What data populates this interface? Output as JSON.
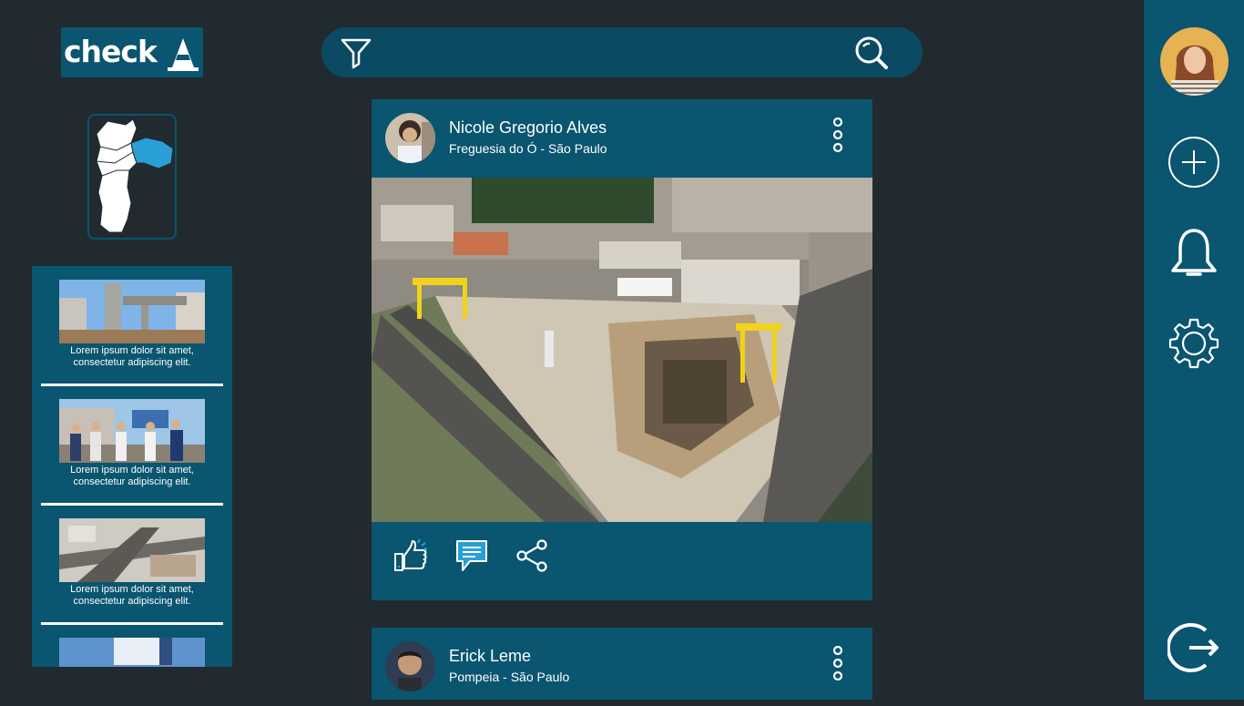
{
  "brand": {
    "logo_text": "check"
  },
  "search": {
    "value": "",
    "placeholder": "",
    "filter_icon": "filter-icon",
    "search_icon": "search-icon"
  },
  "news": {
    "items": [
      {
        "caption_line1": "Lorem ipsum dolor sit amet,",
        "caption_line2": "consectetur adipiscing elit."
      },
      {
        "caption_line1": "Lorem ipsum dolor sit amet,",
        "caption_line2": "consectetur adipiscing elit."
      },
      {
        "caption_line1": "Lorem ipsum dolor sit amet,",
        "caption_line2": "consectetur adipiscing elit."
      }
    ]
  },
  "posts": [
    {
      "author": "Nicole Gregorio Alves",
      "location": "Freguesia do Ó - São Paulo"
    },
    {
      "author": "Erick Leme",
      "location": "Pompeia - São Paulo"
    }
  ],
  "actions": {
    "like_icon": "thumbs-up-icon",
    "comment_icon": "comment-icon",
    "share_icon": "share-icon"
  },
  "rail": {
    "icons": [
      "avatar",
      "add-icon",
      "bell-icon",
      "gear-icon",
      "logout-icon"
    ]
  },
  "colors": {
    "background": "#212a2e",
    "panel": "#0a5570",
    "search_bar": "#0a4b63",
    "accent": "#2a9fd6",
    "text": "#ffffff"
  }
}
